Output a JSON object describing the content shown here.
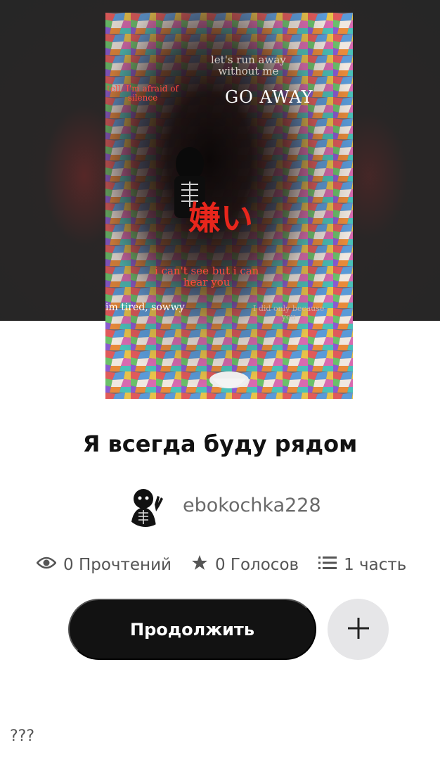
{
  "cover": {
    "text_run_away": "let's run away\nwithout me",
    "text_afraid": "tell, I'm afraid of\nsilence",
    "text_go_away": "GO AWAY",
    "text_kanji": "嫌い",
    "text_cant_see": "i can't see but i can\nhear you",
    "text_tired": "im tired, sowwy",
    "text_only": "I did only because\nyou"
  },
  "story": {
    "title": "Я всегда буду рядом",
    "author": "ebokochka228"
  },
  "stats": {
    "reads": "0 Прочтений",
    "votes": "0 Голосов",
    "parts": "1 часть"
  },
  "actions": {
    "continue_label": "Продолжить",
    "add_icon": "plus-icon"
  },
  "footer": {
    "note": "???"
  },
  "colors": {
    "hero_bg": "#262626",
    "button_dark": "#121212",
    "add_button_bg": "#e6e6e8",
    "accent_red": "#e8261c"
  }
}
